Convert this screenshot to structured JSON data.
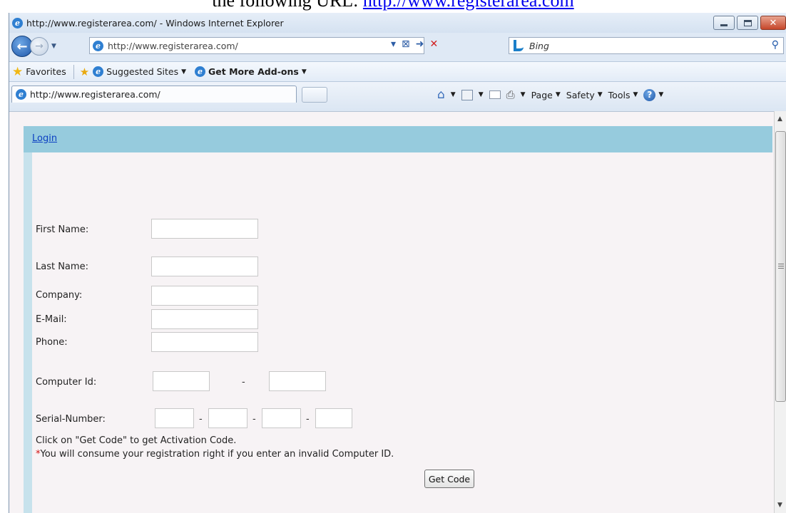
{
  "caption": {
    "prefix": "the following URL: ",
    "link": "http://www.registerarea.com"
  },
  "window": {
    "title": "http://www.registerarea.com/ - Windows Internet Explorer"
  },
  "address_bar": {
    "url": "http://www.registerarea.com/"
  },
  "search": {
    "placeholder": "Bing"
  },
  "favorites_bar": {
    "favorites_label": "Favorites",
    "suggested_sites": "Suggested Sites",
    "get_addons": "Get More Add-ons"
  },
  "tab": {
    "label": "http://www.registerarea.com/"
  },
  "command_bar": {
    "page": "Page",
    "safety": "Safety",
    "tools": "Tools"
  },
  "page": {
    "login_link": "Login",
    "labels": {
      "first_name": "First Name:",
      "last_name": "Last Name:",
      "company": "Company:",
      "email": "E-Mail:",
      "phone": "Phone:",
      "computer_id": "Computer Id:",
      "serial_number": "Serial-Number:"
    },
    "dash": "-",
    "note_get_code": "Click on \"Get Code\" to get Activation Code.",
    "note_asterisk": "*",
    "note_warning": "You will consume your registration right if you enter an invalid Computer ID.",
    "get_code_button": "Get Code"
  },
  "icons": {
    "back": "back-arrow-icon",
    "forward": "forward-arrow-icon",
    "refresh": "refresh-icon",
    "stop": "stop-icon",
    "home": "home-icon",
    "feeds": "feeds-icon",
    "mail": "mail-icon",
    "print": "print-icon",
    "help": "help-icon"
  },
  "colors": {
    "login_header": "#96cbdd",
    "page_background": "#f7f3f5",
    "link": "#0b3fc2",
    "asterisk": "#d21010"
  }
}
